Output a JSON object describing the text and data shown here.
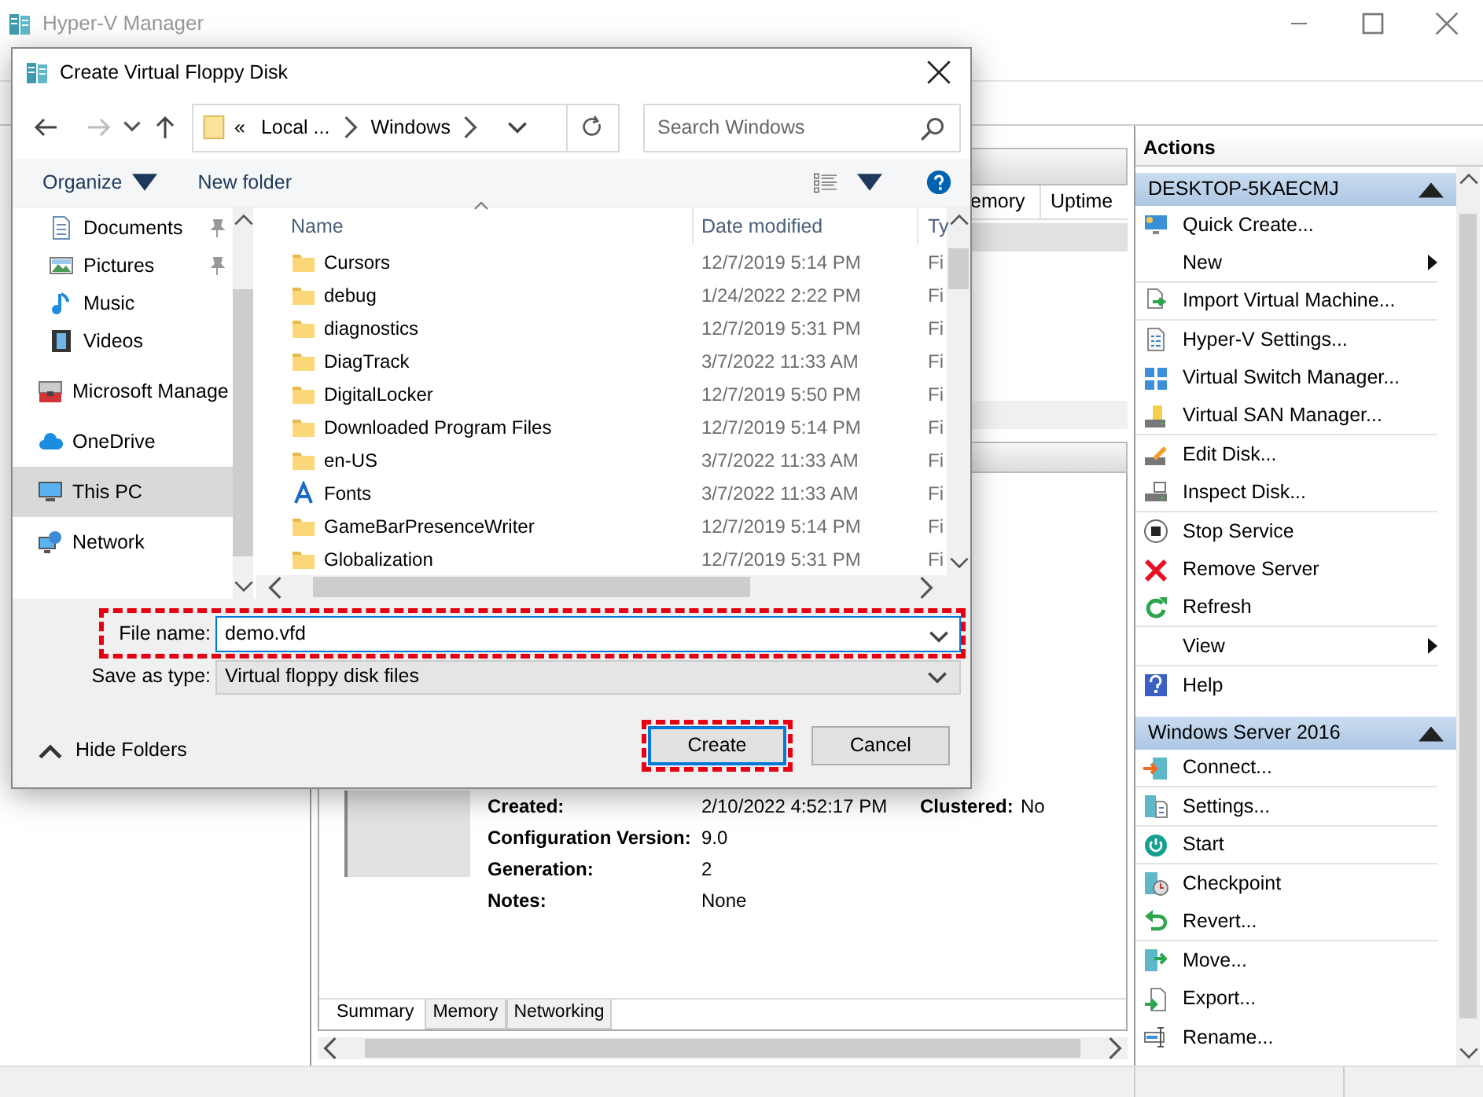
{
  "window": {
    "title": "Hyper-V Manager",
    "active": false
  },
  "vm_list": {
    "columns": [
      "emory",
      "Uptime"
    ]
  },
  "details": {
    "fields": [
      {
        "label": "Created:",
        "value": "2/10/2022 4:52:17 PM"
      },
      {
        "label": "Configuration Version:",
        "value": "9.0"
      },
      {
        "label": "Generation:",
        "value": "2"
      },
      {
        "label": "Notes:",
        "value": "None"
      }
    ],
    "side_field": {
      "label": "Clustered:",
      "value": "No"
    },
    "tabs": [
      {
        "label": "Summary",
        "selected": true
      },
      {
        "label": "Memory",
        "selected": false
      },
      {
        "label": "Networking",
        "selected": false
      }
    ]
  },
  "actions": {
    "title": "Actions",
    "groups": [
      {
        "title": "DESKTOP-5KAECMJ",
        "expanded": true,
        "items": [
          {
            "label": "Quick Create...",
            "submenu": false,
            "divider_below": false
          },
          {
            "label": "New",
            "submenu": true,
            "divider_below": true
          },
          {
            "label": "Import Virtual Machine...",
            "submenu": false,
            "divider_below": true
          },
          {
            "label": "Hyper-V Settings...",
            "submenu": false,
            "divider_below": false
          },
          {
            "label": "Virtual Switch Manager...",
            "submenu": false,
            "divider_below": false
          },
          {
            "label": "Virtual SAN Manager...",
            "submenu": false,
            "divider_below": true
          },
          {
            "label": "Edit Disk...",
            "submenu": false,
            "divider_below": false
          },
          {
            "label": "Inspect Disk...",
            "submenu": false,
            "divider_below": true
          },
          {
            "label": "Stop Service",
            "submenu": false,
            "divider_below": false
          },
          {
            "label": "Remove Server",
            "submenu": false,
            "divider_below": false
          },
          {
            "label": "Refresh",
            "submenu": false,
            "divider_below": true
          },
          {
            "label": "View",
            "submenu": true,
            "divider_below": true
          },
          {
            "label": "Help",
            "submenu": false,
            "divider_below": false
          }
        ]
      },
      {
        "title": "Windows Server 2016",
        "expanded": true,
        "items": [
          {
            "label": "Connect...",
            "submenu": false,
            "divider_below": true
          },
          {
            "label": "Settings...",
            "submenu": false,
            "divider_below": true
          },
          {
            "label": "Start",
            "submenu": false,
            "divider_below": true
          },
          {
            "label": "Checkpoint",
            "submenu": false,
            "divider_below": false
          },
          {
            "label": "Revert...",
            "submenu": false,
            "divider_below": true
          },
          {
            "label": "Move...",
            "submenu": false,
            "divider_below": false
          },
          {
            "label": "Export...",
            "submenu": false,
            "divider_below": false
          },
          {
            "label": "Rename...",
            "submenu": false,
            "divider_below": false
          }
        ]
      }
    ]
  },
  "dialog": {
    "title": "Create Virtual Floppy Disk",
    "navigation": {
      "back_disabled": false,
      "forward_disabled": true
    },
    "address": {
      "overflow": "«",
      "path": [
        "Local ...",
        "Windows"
      ]
    },
    "search": {
      "placeholder": "Search Windows"
    },
    "commands": {
      "organize": "Organize",
      "new_folder": "New folder"
    },
    "nav_pane": [
      {
        "label": "Documents",
        "pinned": true,
        "selected": false
      },
      {
        "label": "Pictures",
        "pinned": true,
        "selected": false
      },
      {
        "label": "Music",
        "pinned": false,
        "selected": false
      },
      {
        "label": "Videos",
        "pinned": false,
        "selected": false
      },
      {
        "label": "Microsoft Manage",
        "pinned": false,
        "selected": false
      },
      {
        "label": "OneDrive",
        "pinned": false,
        "selected": false
      },
      {
        "label": "This PC",
        "pinned": false,
        "selected": true
      },
      {
        "label": "Network",
        "pinned": false,
        "selected": false
      }
    ],
    "columns": [
      "Name",
      "Date modified",
      "Ty"
    ],
    "files": [
      {
        "name": "Cursors",
        "date": "12/7/2019 5:14 PM",
        "type": "Fi",
        "kind": "folder"
      },
      {
        "name": "debug",
        "date": "1/24/2022 2:22 PM",
        "type": "Fi",
        "kind": "folder"
      },
      {
        "name": "diagnostics",
        "date": "12/7/2019 5:31 PM",
        "type": "Fi",
        "kind": "folder"
      },
      {
        "name": "DiagTrack",
        "date": "3/7/2022 11:33 AM",
        "type": "Fi",
        "kind": "folder"
      },
      {
        "name": "DigitalLocker",
        "date": "12/7/2019 5:50 PM",
        "type": "Fi",
        "kind": "folder"
      },
      {
        "name": "Downloaded Program Files",
        "date": "12/7/2019 5:14 PM",
        "type": "Fi",
        "kind": "folder"
      },
      {
        "name": "en-US",
        "date": "3/7/2022 11:33 AM",
        "type": "Fi",
        "kind": "folder"
      },
      {
        "name": "Fonts",
        "date": "3/7/2022 11:33 AM",
        "type": "Fi",
        "kind": "fonts"
      },
      {
        "name": "GameBarPresenceWriter",
        "date": "12/7/2019 5:14 PM",
        "type": "Fi",
        "kind": "folder"
      },
      {
        "name": "Globalization",
        "date": "12/7/2019 5:31 PM",
        "type": "Fi",
        "kind": "folder"
      }
    ],
    "file_name": {
      "label": "File name:",
      "value": "demo.vfd",
      "highlighted": true
    },
    "save_type": {
      "label": "Save as type:",
      "value": "Virtual floppy disk files"
    },
    "hide_folders": "Hide Folders",
    "buttons": [
      {
        "label": "Create",
        "default": true,
        "highlighted": true
      },
      {
        "label": "Cancel",
        "default": false,
        "highlighted": false
      }
    ]
  }
}
